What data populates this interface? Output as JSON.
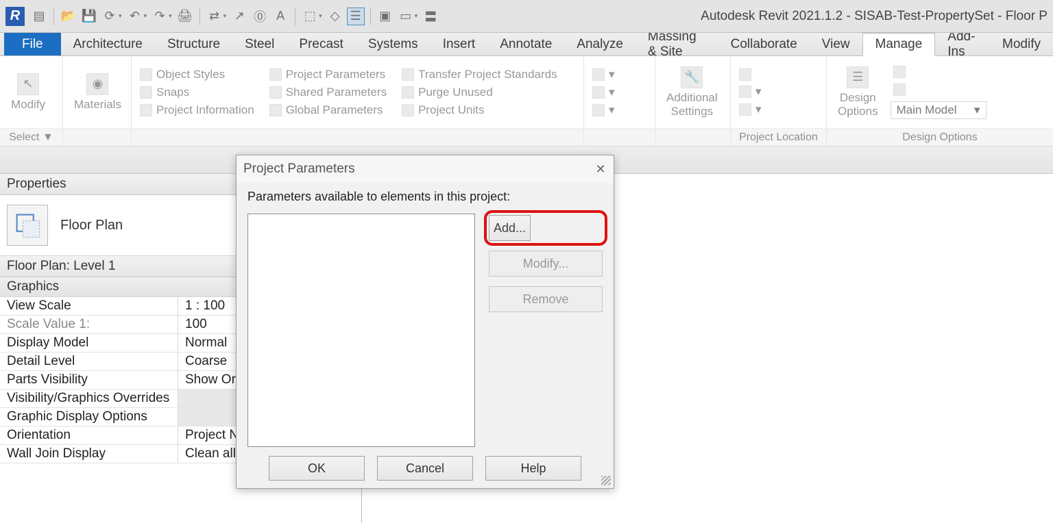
{
  "colors": {
    "accent": "#1b6ec2",
    "highlight": "#d11"
  },
  "app": {
    "title": "Autodesk Revit 2021.1.2 - SISAB-Test-PropertySet - Floor P"
  },
  "tabs": [
    {
      "label": "File",
      "type": "file"
    },
    {
      "label": "Architecture"
    },
    {
      "label": "Structure"
    },
    {
      "label": "Steel"
    },
    {
      "label": "Precast"
    },
    {
      "label": "Systems"
    },
    {
      "label": "Insert"
    },
    {
      "label": "Annotate"
    },
    {
      "label": "Analyze"
    },
    {
      "label": "Massing & Site"
    },
    {
      "label": "Collaborate"
    },
    {
      "label": "View"
    },
    {
      "label": "Manage",
      "active": true
    },
    {
      "label": "Add-Ins"
    },
    {
      "label": "Modify"
    }
  ],
  "ribbon": {
    "select_panel": {
      "label": "Select ▼",
      "modify": "Modify"
    },
    "materials_panel": {
      "materials": "Materials"
    },
    "settings_panel": {
      "object_styles": "Object  Styles",
      "snaps": "Snaps",
      "project_information": "Project  Information",
      "project_parameters": "Project  Parameters",
      "shared_parameters": "Shared  Parameters",
      "global_parameters": "Global  Parameters",
      "transfer_standards": "Transfer  Project Standards",
      "purge_unused": "Purge  Unused",
      "project_units": "Project  Units"
    },
    "additional_settings": "Additional\nSettings",
    "location_panel": {
      "label": "Project Location"
    },
    "design": {
      "design_options": "Design\nOptions",
      "main_model": "Main Model",
      "panel_label": "Design Options"
    }
  },
  "properties": {
    "palette_title": "Properties",
    "type_name": "Floor Plan",
    "instance_title": "Floor Plan: Level 1",
    "group1": "Graphics",
    "rows": [
      {
        "name": "View Scale",
        "value": "1 : 100"
      },
      {
        "name": "Scale Value    1:",
        "value": "100",
        "readonly": true
      },
      {
        "name": "Display Model",
        "value": "Normal"
      },
      {
        "name": "Detail Level",
        "value": "Coarse"
      },
      {
        "name": "Parts Visibility",
        "value": "Show Ori"
      },
      {
        "name": "Visibility/Graphics Overrides",
        "value": "",
        "btn": true
      },
      {
        "name": "Graphic Display Options",
        "value": "",
        "btn": true
      },
      {
        "name": "Orientation",
        "value": "Project N"
      },
      {
        "name": "Wall Join Display",
        "value": "Clean all wall joins"
      }
    ]
  },
  "dialog": {
    "title": "Project Parameters",
    "subtitle": "Parameters available to elements in this project:",
    "btn_add": "Add...",
    "btn_modify": "Modify...",
    "btn_remove": "Remove",
    "btn_ok": "OK",
    "btn_cancel": "Cancel",
    "btn_help": "Help"
  }
}
